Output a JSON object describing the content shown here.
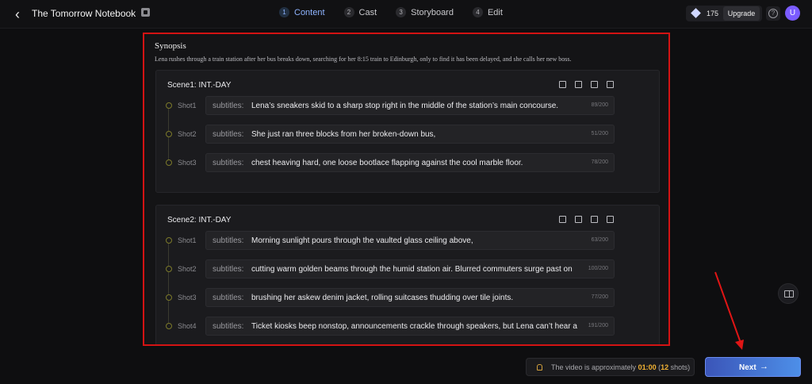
{
  "header": {
    "title": "The Tomorrow Notebook",
    "steps": [
      {
        "num": "1",
        "label": "Content"
      },
      {
        "num": "2",
        "label": "Cast"
      },
      {
        "num": "3",
        "label": "Storyboard"
      },
      {
        "num": "4",
        "label": "Edit"
      }
    ],
    "credits": "175",
    "upgrade_label": "Upgrade",
    "help": "?",
    "avatar": "U"
  },
  "synopsis": {
    "title": "Synopsis",
    "text": "Lena rushes through a train station after her bus breaks down, searching for her 8:15 train to Edinburgh, only to find it has been delayed, and she calls her new boss."
  },
  "scenes": [
    {
      "title": "Scene1: INT.-DAY",
      "shots": [
        {
          "label": "Shot1",
          "prefix": "subtitles:",
          "text": "Lena’s sneakers skid to a sharp stop right in the middle of the station’s main concourse.",
          "count": "89/200"
        },
        {
          "label": "Shot2",
          "prefix": "subtitles:",
          "text": "She just ran three blocks from her broken-down bus,",
          "count": "51/200"
        },
        {
          "label": "Shot3",
          "prefix": "subtitles:",
          "text": "chest heaving hard, one loose bootlace flapping against the cool marble floor.",
          "count": "78/200"
        }
      ]
    },
    {
      "title": "Scene2: INT.-DAY",
      "shots": [
        {
          "label": "Shot1",
          "prefix": "subtitles:",
          "text": "Morning sunlight pours through the vaulted glass ceiling above,",
          "count": "63/200"
        },
        {
          "label": "Shot2",
          "prefix": "subtitles:",
          "text": "cutting warm golden beams through the humid station air. Blurred commuters surge past on",
          "count": "100/200"
        },
        {
          "label": "Shot3",
          "prefix": "subtitles:",
          "text": "brushing her askew denim jacket, rolling suitcases thudding over tile joints.",
          "count": "77/200"
        },
        {
          "label": "Shot4",
          "prefix": "subtitles:",
          "text": "Ticket kiosks beep nonstop, announcements crackle through speakers, but Lena can’t hear a",
          "count": "191/200"
        }
      ]
    }
  ],
  "footer": {
    "estimate_prefix": "The video is approximately",
    "estimate_time": "01:00",
    "estimate_shots_open": "(",
    "estimate_shots": "12",
    "estimate_shots_close": "shots)",
    "next_label": "Next",
    "next_arrow": "→"
  },
  "colors": {
    "accent": "#4d8fe8",
    "highlight_border": "#d31313",
    "estimate_highlight": "#f2b233"
  }
}
